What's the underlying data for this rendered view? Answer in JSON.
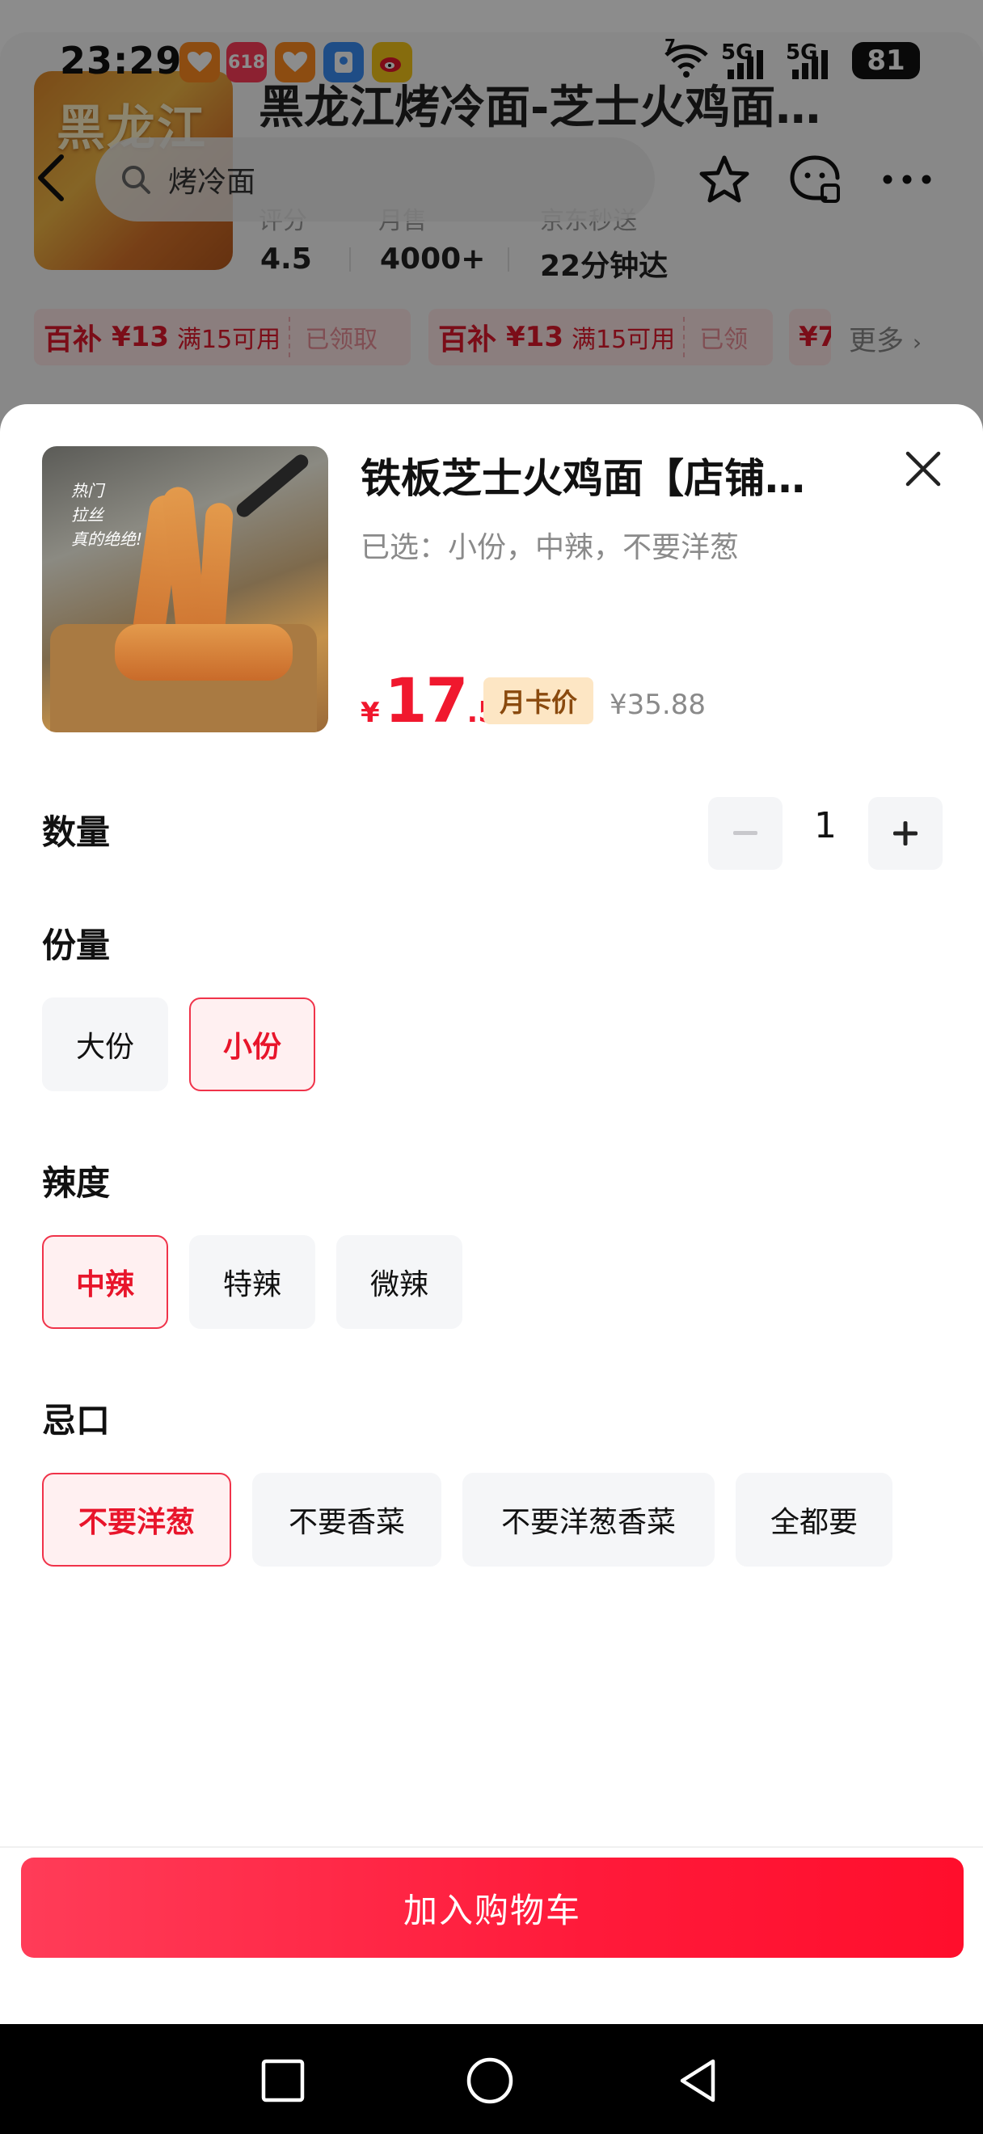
{
  "status_bar": {
    "time": "23:29",
    "network_1": "5G",
    "network_2": "5G",
    "wifi_badge": "7",
    "battery": "81",
    "apps": [
      "taobao-app-icon",
      "618-app-icon",
      "taobao-app-icon",
      "kuake-app-icon",
      "weibo-app-icon"
    ]
  },
  "search": {
    "value": "烤冷面"
  },
  "store": {
    "thumb_text": "黑龙江",
    "title": "黑龙江烤冷面-芝士火鸡面…",
    "stats": [
      {
        "label": "评分",
        "value": "4.5"
      },
      {
        "label": "月售",
        "value": "4000+"
      },
      {
        "label": "京东秒送",
        "value": "22分钟达"
      }
    ],
    "coupons": [
      {
        "tag": "百补",
        "amount": "¥13",
        "condition": "满15可用",
        "status": "已领取"
      },
      {
        "tag": "百补",
        "amount": "¥13",
        "condition": "满15可用",
        "status": "已领"
      },
      {
        "tag": "",
        "amount": "¥7",
        "condition": "",
        "status": ""
      }
    ],
    "more_label": "更多"
  },
  "product": {
    "title": "铁板芝士火鸡面【店铺…",
    "image_note_line1": "热门",
    "image_note_line2": "拉丝",
    "image_note_line3": "真的绝绝!",
    "selected_summary": "已选：小份，中辣，不要洋葱",
    "price_currency": "¥",
    "price_integer": "17",
    "price_decimal": ".5",
    "card_badge": "月卡价",
    "original_price": "¥35.88"
  },
  "quantity": {
    "label": "数量",
    "value": "1"
  },
  "portion": {
    "label": "份量",
    "options": [
      "大份",
      "小份"
    ],
    "selected": "小份"
  },
  "spice": {
    "label": "辣度",
    "options": [
      "中辣",
      "特辣",
      "微辣"
    ],
    "selected": "中辣"
  },
  "avoid": {
    "label": "忌口",
    "options": [
      "不要洋葱",
      "不要香菜",
      "不要洋葱香菜",
      "全都要"
    ],
    "selected": "不要洋葱"
  },
  "cart_button": {
    "label": "加入购物车"
  },
  "colors": {
    "accent_red": "#f0182e",
    "selected_bg": "#fff0f1",
    "badge_bg": "#fde6c4",
    "cart_gradient_start": "#ff3c58",
    "cart_gradient_end": "#ff0e2c"
  }
}
